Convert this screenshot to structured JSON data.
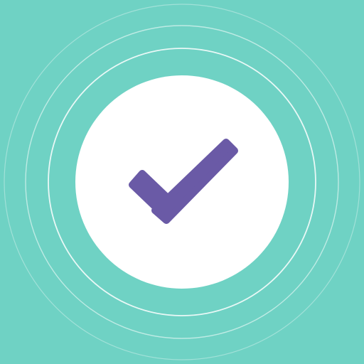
{
  "colors": {
    "background": "#6fd2c4",
    "circle_fill": "#ffffff",
    "rings": "#ffffff",
    "check": "#6a5aa6",
    "check_shadow": "#4f4185"
  },
  "icon": {
    "name": "checkmark-icon"
  }
}
